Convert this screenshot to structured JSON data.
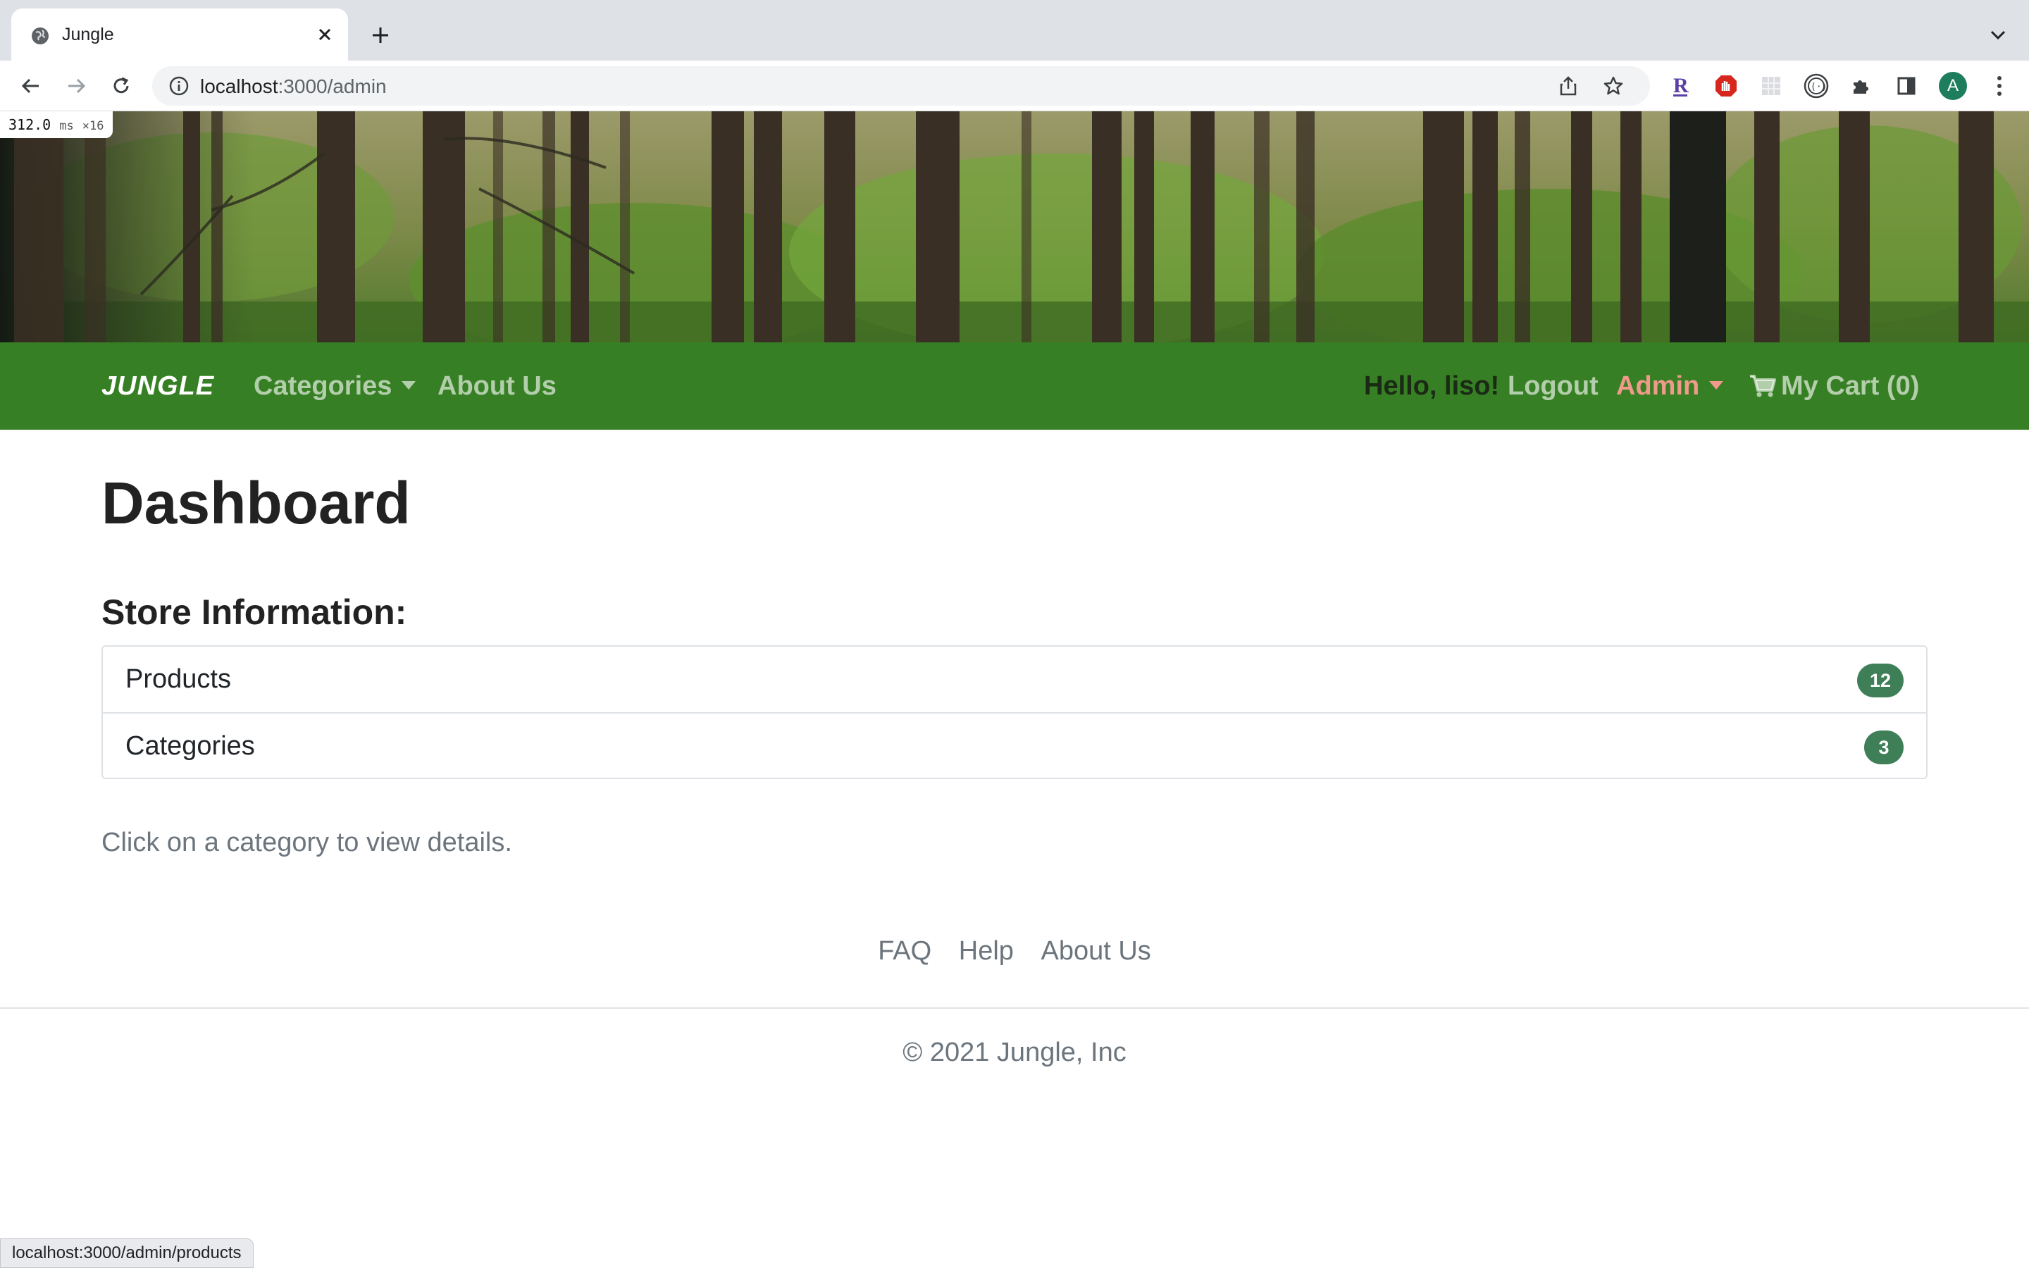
{
  "browser": {
    "tab_title": "Jungle",
    "url_host": "localhost",
    "url_rest": ":3000/admin",
    "status_url": "localhost:3000/admin/products",
    "profile_initial": "A",
    "extensions": [
      "readability-extension-icon",
      "shield-extension-icon",
      "grid-extension-icon",
      "code-extension-icon",
      "puzzle-icon",
      "side-panel-icon"
    ]
  },
  "perf": {
    "value": "312.0",
    "unit": "ms",
    "multiplier": "×16"
  },
  "navbar": {
    "brand": "JUNGLE",
    "categories": "Categories",
    "about": "About Us",
    "greeting": "Hello, liso!",
    "logout": "Logout",
    "admin": "Admin",
    "cart": "My Cart (0)"
  },
  "main": {
    "title": "Dashboard",
    "section_title": "Store Information:",
    "items": [
      {
        "label": "Products",
        "count": "12"
      },
      {
        "label": "Categories",
        "count": "3"
      }
    ],
    "hint": "Click on a category to view details."
  },
  "footer": {
    "links": [
      "FAQ",
      "Help",
      "About Us"
    ],
    "copyright": "© 2021 Jungle, Inc"
  },
  "colors": {
    "navbar": "#377f24",
    "badge": "#3e7f57",
    "admin_link": "#f09a8c"
  }
}
